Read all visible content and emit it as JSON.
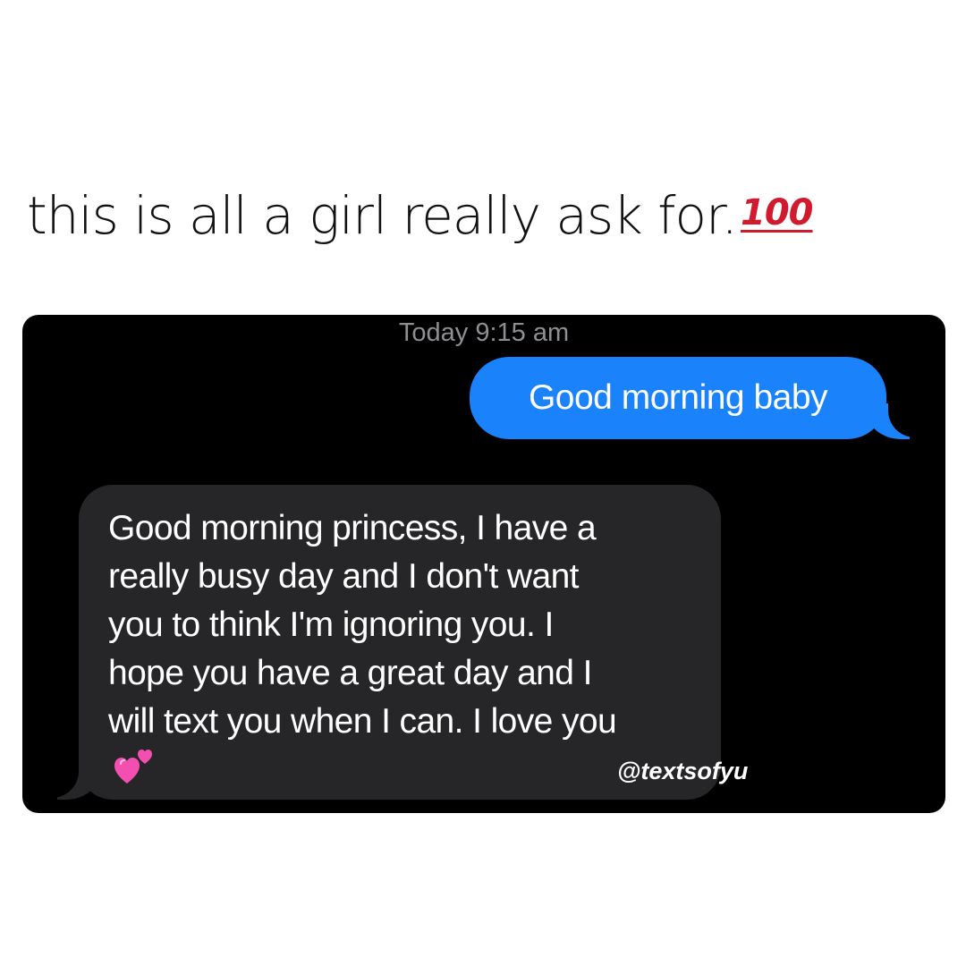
{
  "post": {
    "caption": "this is all a girl really ask for.",
    "caption_emoji": "100",
    "caption_emoji_icon": "hundred-points-icon",
    "accent_colors": {
      "hundred_emoji": "#d21a2e"
    }
  },
  "conversation": {
    "timestamp": "Today 9:15 am",
    "messages": [
      {
        "direction": "outgoing",
        "text": "Good morning baby"
      },
      {
        "direction": "incoming",
        "lines": [
          "Good morning princess, I have a",
          "really busy day and I don't want",
          "you to think I'm ignoring you. I",
          "hope you have a great day and I",
          "will text you when I can. I love you"
        ],
        "trailing_emoji_icon": "two-hearts-icon"
      }
    ],
    "colors": {
      "background": "#000000",
      "outgoing_bubble": "#1a82fb",
      "incoming_bubble": "#262628",
      "timestamp_text": "#8e8e93"
    }
  },
  "watermark": "@textsofyu"
}
